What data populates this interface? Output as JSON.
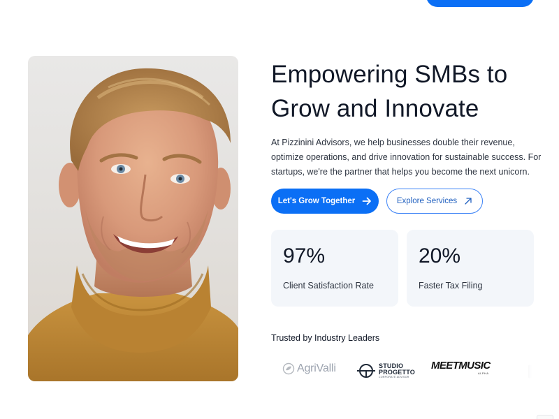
{
  "hero": {
    "title_line1": "Empowering SMBs to",
    "title_line2": "Grow and Innovate",
    "description": "At Pizzinini Advisors, we help businesses double their revenue, optimize operations, and drive innovation for sustainable success. For startups, we're the partner that helps you become the next unicorn.",
    "primary_button": {
      "label": "Let's Grow Together",
      "icon": "arrow-right-icon"
    },
    "secondary_button": {
      "label": "Explore Services",
      "icon": "arrow-up-right-icon"
    }
  },
  "stats": [
    {
      "value": "97%",
      "label": "Client Satisfaction Rate"
    },
    {
      "value": "20%",
      "label": "Faster Tax Filing"
    }
  ],
  "trusted": {
    "title": "Trusted by Industry Leaders",
    "logos": [
      {
        "name": "AgriValli",
        "text": "AgriValli"
      },
      {
        "name": "Studio Progetto",
        "line1": "STUDIO",
        "line2": "PROGETTO",
        "sub": "CORPORATE ADVISOR"
      },
      {
        "name": "MeetMusic",
        "text": "MEETMUSIC",
        "sub": "ALPHA"
      }
    ]
  },
  "colors": {
    "accent": "#0b6ff5",
    "card_background": "#f3f6fa",
    "text_primary": "#111827",
    "text_secondary": "#2d3440",
    "sweater": "#c08a3a"
  }
}
